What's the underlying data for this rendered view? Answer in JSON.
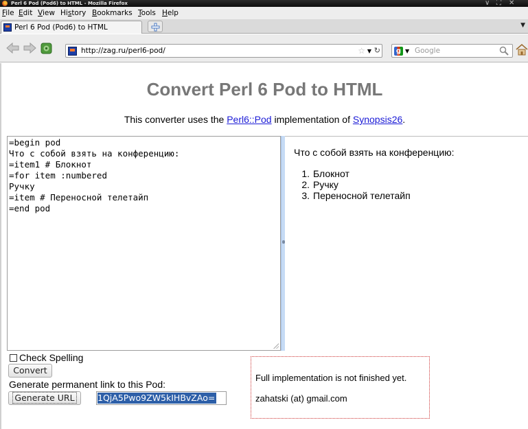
{
  "window": {
    "title": "Perl 6 Pod (Pod6) to HTML - Mozilla Firefox",
    "controls": [
      "∨",
      "⛶",
      "✕"
    ]
  },
  "menu": {
    "items": [
      {
        "underline": "F",
        "rest": "ile"
      },
      {
        "underline": "E",
        "rest": "dit"
      },
      {
        "underline": "V",
        "rest": "iew"
      },
      {
        "pre": "Hi",
        "underline": "s",
        "rest": "tory"
      },
      {
        "underline": "B",
        "rest": "ookmarks"
      },
      {
        "underline": "T",
        "rest": "ools"
      },
      {
        "underline": "H",
        "rest": "elp"
      }
    ]
  },
  "tabs": [
    {
      "title": "Perl 6 Pod (Pod6) to HTML",
      "active": true
    }
  ],
  "navbar": {
    "url": "http://zag.ru/perl6-pod/",
    "search_placeholder": "Google"
  },
  "icons": {
    "back": "back-arrow-icon",
    "forward": "forward-arrow-icon",
    "stop": "stop-icon",
    "star": "bookmark-star-icon",
    "reload": "reload-icon",
    "search": "magnifier-icon",
    "home": "home-icon",
    "new_tab": "plus-icon"
  },
  "page": {
    "heading": "Convert Perl 6 Pod to HTML",
    "intro": {
      "before": "This converter uses the ",
      "link1": "Perl6::Pod",
      "middle": " implementation of ",
      "link2": "Synopsis26",
      "after": "."
    },
    "editor_text": "=begin pod\nЧто с собой взять на конференцию:\n=item1 # Блокнот\n=for item :numbered\nРучку\n=item # Переносной телетайп\n=end pod",
    "preview": {
      "paragraph": "Что с собой взять на конференцию:",
      "items": [
        {
          "num": "1.",
          "text": "Блокнот"
        },
        {
          "num": "2.",
          "text": "Ручку"
        },
        {
          "num": "3.",
          "text": "Переносной телетайп"
        }
      ]
    },
    "check_spelling_label": "Check Spelling",
    "check_spelling_checked": false,
    "convert_label": "Convert",
    "permalink_label": "Generate permanent link to this Pod:",
    "generate_url_label": "Generate URL",
    "url_field_value": "1QjA5Pwo9ZW5kIHBvZAo=",
    "notice_line1": "Full implementation is not finished yet.",
    "notice_line2": "zahatski (at) gmail.com"
  },
  "colors": {
    "heading": "#777777",
    "link": "#1a1ad6",
    "selection": "#2d5fa8",
    "notice_border": "#cc3333",
    "splitter": "#c6dbf5"
  }
}
